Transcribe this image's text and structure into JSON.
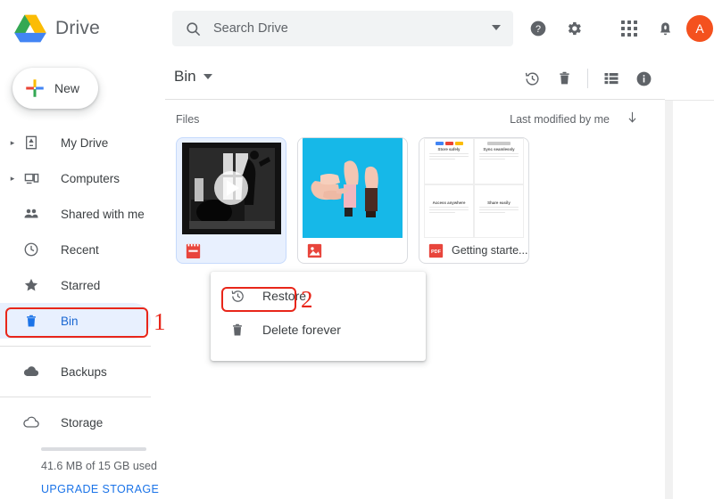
{
  "app": {
    "brand_name": "Drive",
    "logo_colors": {
      "green": "#34a853",
      "yellow": "#fbbc05",
      "blue": "#4285f4"
    }
  },
  "sidebar": {
    "new_button": {
      "label": "New",
      "icon": "plus-icon"
    },
    "items": [
      {
        "label": "My Drive",
        "icon": "my-drive-icon",
        "expandable": true,
        "active": false
      },
      {
        "label": "Computers",
        "icon": "computer-icon",
        "expandable": true,
        "active": false
      },
      {
        "label": "Shared with me",
        "icon": "people-icon",
        "expandable": false,
        "active": false
      },
      {
        "label": "Recent",
        "icon": "clock-icon",
        "expandable": false,
        "active": false
      },
      {
        "label": "Starred",
        "icon": "star-icon",
        "expandable": false,
        "active": false
      },
      {
        "label": "Bin",
        "icon": "trash-icon",
        "expandable": false,
        "active": true
      },
      {
        "label": "Backups",
        "icon": "backup-icon",
        "expandable": false,
        "active": false
      }
    ],
    "storage": {
      "label": "Storage",
      "icon": "cloud-icon",
      "usage_text": "41.6 MB of 15 GB used",
      "upgrade_label": "UPGRADE STORAGE",
      "used_percent": 0.27
    },
    "active_color": "#1967d2",
    "active_bg": "#e8f0fe"
  },
  "header": {
    "search": {
      "placeholder": "Search Drive",
      "value": "",
      "icon": "search-icon",
      "options_icon": "chevron-down-icon"
    },
    "help_icon": "help-icon",
    "settings_icon": "gear-icon",
    "apps_icon": "apps-grid-icon",
    "notifications_icon": "bell-icon",
    "avatar": {
      "initial": "A",
      "color": "#f4511e"
    }
  },
  "toolbar": {
    "breadcrumb": "Bin",
    "breadcrumb_caret": "chevron-down-icon",
    "restore_icon": "restore-icon",
    "delete_icon": "trash-icon",
    "list_view_icon": "list-view-icon",
    "details_icon": "info-icon"
  },
  "files_section": {
    "section_label": "Files",
    "sort_label": "Last modified by me",
    "sort_direction_icon": "arrow-down-icon",
    "cards": [
      {
        "name": "",
        "type": "video",
        "file_icon": "video-file-icon",
        "selected": true,
        "thumb": "video-bw-silhouette-window"
      },
      {
        "name": "",
        "type": "image",
        "file_icon": "image-file-icon",
        "selected": false,
        "thumb": "photo-hands-cyan"
      },
      {
        "name": "Getting starte...",
        "type": "pdf",
        "file_icon": "pdf-file-icon",
        "selected": false,
        "thumb": "pdf-getting-started",
        "preview_cells": [
          "Store safely",
          "Sync seamlessly",
          "Access anywhere",
          "Share easily"
        ]
      }
    ]
  },
  "context_menu": {
    "items": [
      {
        "label": "Restore",
        "icon": "restore-icon",
        "highlighted": true
      },
      {
        "label": "Delete forever",
        "icon": "trash-icon",
        "highlighted": false
      }
    ]
  },
  "annotations": {
    "color": "#e8261a",
    "markers": [
      {
        "number": "1",
        "target": "sidebar-item-bin"
      },
      {
        "number": "2",
        "target": "context-menu-item-restore"
      }
    ]
  }
}
